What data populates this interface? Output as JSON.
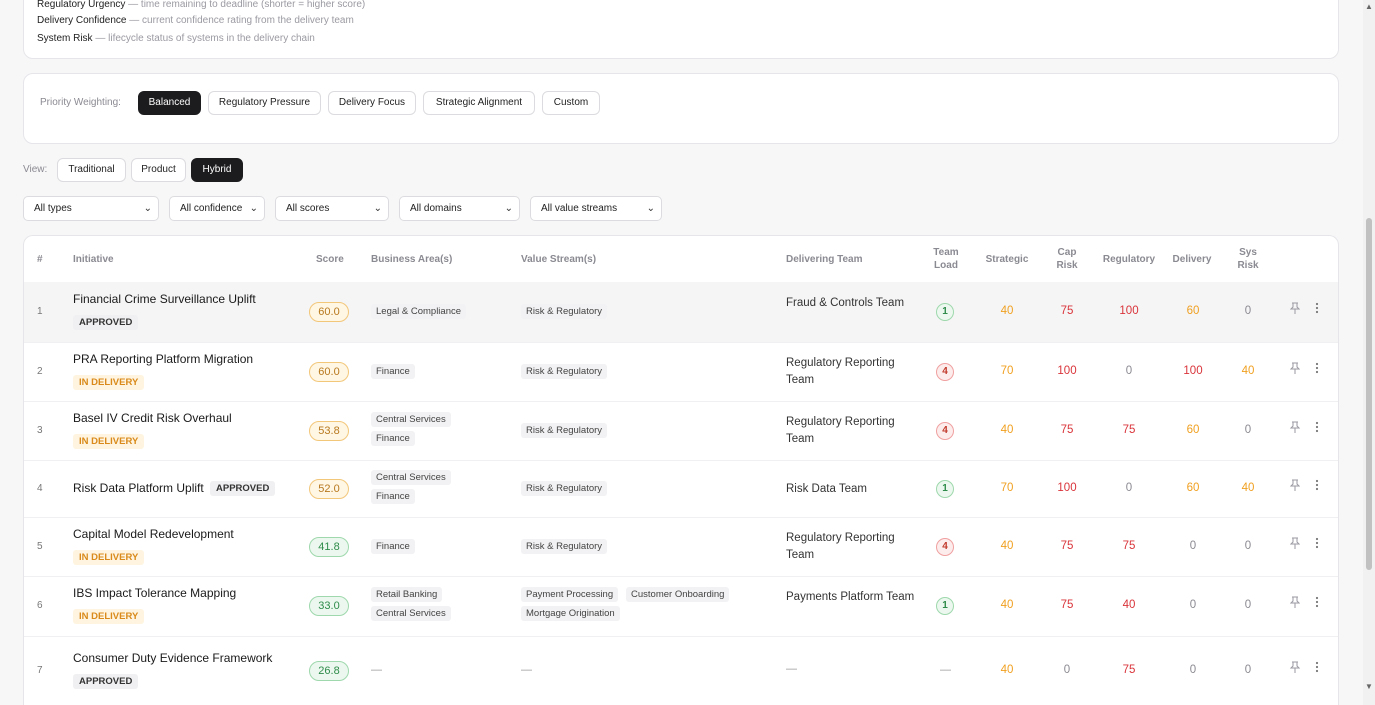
{
  "legend": [
    {
      "term": "Regulatory Urgency",
      "desc": " — time remaining to deadline (shorter = higher score)"
    },
    {
      "term": "Delivery Confidence",
      "desc": " — current confidence rating from the delivery team"
    },
    {
      "term": "System Risk",
      "desc": " — lifecycle status of systems in the delivery chain"
    }
  ],
  "weighting": {
    "label": "Priority Weighting:",
    "options": [
      "Balanced",
      "Regulatory Pressure",
      "Delivery Focus",
      "Strategic Alignment",
      "Custom"
    ],
    "selected": "Balanced"
  },
  "view": {
    "label": "View:",
    "options": [
      "Traditional",
      "Product",
      "Hybrid"
    ],
    "selected": "Hybrid"
  },
  "filters": [
    "All types",
    "All confidence",
    "All scores",
    "All domains",
    "All value streams"
  ],
  "table": {
    "headers": {
      "num": "#",
      "initiative": "Initiative",
      "score": "Score",
      "business": "Business Area(s)",
      "value": "Value Stream(s)",
      "team": "Delivering Team",
      "load1": "Team",
      "load2": "Load",
      "strategic": "Strategic",
      "cap1": "Cap",
      "cap2": "Risk",
      "regulatory": "Regulatory",
      "delivery": "Delivery",
      "sys1": "Sys",
      "sys2": "Risk"
    },
    "rows": [
      {
        "num": "1",
        "name": "Financial Crime Surveillance Uplift",
        "status": "APPROVED",
        "score": "60.0",
        "areas": [
          "Legal & Compliance"
        ],
        "streams": [
          "Risk & Regulatory"
        ],
        "team": "Fraud & Controls Team",
        "load": "1",
        "strategic": "40",
        "cap": "75",
        "regulatory": "100",
        "delivery": "60",
        "sys": "0"
      },
      {
        "num": "2",
        "name": "PRA Reporting Platform Migration",
        "status": "IN DELIVERY",
        "score": "60.0",
        "areas": [
          "Finance"
        ],
        "streams": [
          "Risk & Regulatory"
        ],
        "team": "Regulatory Reporting Team",
        "load": "4",
        "strategic": "70",
        "cap": "100",
        "regulatory": "0",
        "delivery": "100",
        "sys": "40"
      },
      {
        "num": "3",
        "name": "Basel IV Credit Risk Overhaul",
        "status": "IN DELIVERY",
        "score": "53.8",
        "areas": [
          "Central Services",
          "Finance"
        ],
        "streams": [
          "Risk & Regulatory"
        ],
        "team": "Regulatory Reporting Team",
        "load": "4",
        "strategic": "40",
        "cap": "75",
        "regulatory": "75",
        "delivery": "60",
        "sys": "0"
      },
      {
        "num": "4",
        "name": "Risk Data Platform Uplift",
        "status": "APPROVED",
        "score": "52.0",
        "areas": [
          "Central Services",
          "Finance"
        ],
        "streams": [
          "Risk & Regulatory"
        ],
        "team": "Risk Data Team",
        "load": "1",
        "strategic": "70",
        "cap": "100",
        "regulatory": "0",
        "delivery": "60",
        "sys": "40"
      },
      {
        "num": "5",
        "name": "Capital Model Redevelopment",
        "status": "IN DELIVERY",
        "score": "41.8",
        "areas": [
          "Finance"
        ],
        "streams": [
          "Risk & Regulatory"
        ],
        "team": "Regulatory Reporting Team",
        "load": "4",
        "strategic": "40",
        "cap": "75",
        "regulatory": "75",
        "delivery": "0",
        "sys": "0"
      },
      {
        "num": "6",
        "name": "IBS Impact Tolerance Mapping",
        "status": "IN DELIVERY",
        "score": "33.0",
        "areas": [
          "Retail Banking",
          "Central Services"
        ],
        "streams": [
          "Payment Processing",
          "Customer Onboarding",
          "Mortgage Origination"
        ],
        "team": "Payments Platform Team",
        "load": "1",
        "strategic": "40",
        "cap": "75",
        "regulatory": "40",
        "delivery": "0",
        "sys": "0"
      },
      {
        "num": "7",
        "name": "Consumer Duty Evidence Framework",
        "status": "APPROVED",
        "score": "26.8",
        "areas": "—",
        "streams": "—",
        "team": "—",
        "load": "—",
        "strategic": "40",
        "cap": "0",
        "regulatory": "75",
        "delivery": "0",
        "sys": "0"
      }
    ]
  },
  "colors": {
    "orange": "#f0a020",
    "red": "#d9343a",
    "gray": "#8a8a92",
    "dark": "#1c1c1f"
  },
  "icons": [
    "pin-icon",
    "more-vertical-icon",
    "chevron-down-icon"
  ]
}
